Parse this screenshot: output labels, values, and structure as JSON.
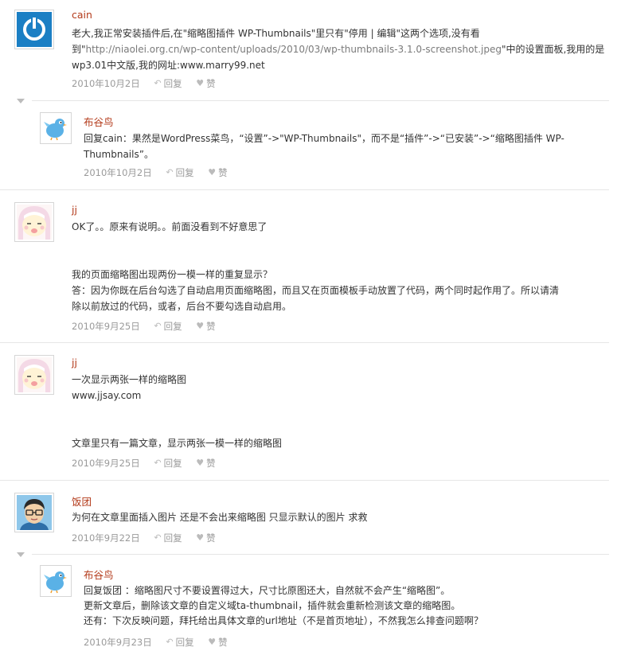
{
  "comments": [
    {
      "author": "cain",
      "avatar": "power-logo-avatar",
      "lines": [
        "老大,我正常安装插件后,在\"缩略图插件 WP-Thumbnails\"里只有\"停用 | 编辑\"这两个选项,没有看",
        "到\"",
        "wp3.01中文版,我的网址:www.marry99.net"
      ],
      "link_text": "http://niaolei.org.cn/wp-content/uploads/2010/03/wp-thumbnails-3.1.0-screenshot.jpeg",
      "link_tail": "\"中的设置面板,我用的是",
      "date": "2010年10月2日",
      "reply_label": "回复",
      "like_label": "赞"
    },
    {
      "author": "布谷鸟",
      "avatar": "twitter-bird-avatar",
      "lines": [
        "回复cain：果然是WordPress菜鸟，“设置”->\"WP-Thumbnails\"，而不是“插件”->“已安装”->“缩略图插件 WP-",
        "Thumbnails”。"
      ],
      "date": "2010年10月2日",
      "reply_label": "回复",
      "like_label": "赞"
    },
    {
      "author": "jj",
      "avatar": "cartoon-face-avatar",
      "lines": [
        "OK了。。原来有说明。。前面没看到不好意思了",
        "",
        "",
        "我的页面缩略图出现两份一模一样的重复显示？",
        "答：因为你既在后台勾选了自动启用页面缩略图，而且又在页面模板手动放置了代码，两个同时起作用了。所以请清",
        "除以前放过的代码，或者，后台不要勾选自动启用。"
      ],
      "date": "2010年9月25日",
      "reply_label": "回复",
      "like_label": "赞"
    },
    {
      "author": "jj",
      "avatar": "cartoon-face-avatar",
      "lines": [
        "一次显示两张一样的缩略图",
        "www.jjsay.com",
        "",
        "",
        "文章里只有一篇文章，显示两张一模一样的缩略图"
      ],
      "date": "2010年9月25日",
      "reply_label": "回复",
      "like_label": "赞"
    },
    {
      "author": "饭团",
      "avatar": "glasses-man-avatar",
      "lines": [
        "为何在文章里面插入图片 还是不会出来缩略图 只显示默认的图片 求救"
      ],
      "date": "2010年9月22日",
      "reply_label": "回复",
      "like_label": "赞"
    },
    {
      "author": "布谷鸟",
      "avatar": "twitter-bird-avatar",
      "lines": [
        "回复饭团 ：缩略图尺寸不要设置得过大，尺寸比原图还大，自然就不会产生“缩略图”。",
        "更新文章后，删除该文章的自定义域ta-thumbnail，插件就会重新检测该文章的缩略图。",
        "还有：下次反映问题，拜托给出具体文章的url地址（不是首页地址），不然我怎么排查问题啊？"
      ],
      "date": "2010年9月23日",
      "reply_label": "回复",
      "like_label": "赞"
    }
  ],
  "colors": {
    "author": "#b33a1a",
    "meta": "#9a9a9a",
    "divider": "#e6e6e6",
    "accent_blue": "#1b7fc4"
  },
  "icons": {
    "reply": "reply-arrow-icon",
    "like": "heart-icon",
    "thread": "thread-collapse-icon"
  }
}
